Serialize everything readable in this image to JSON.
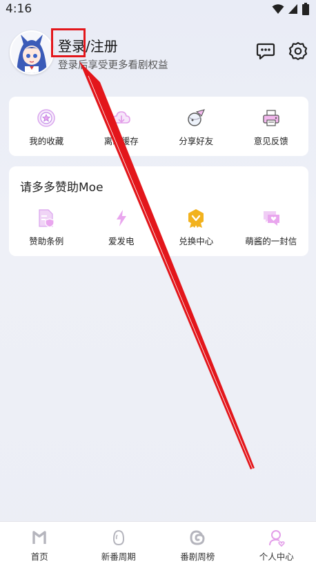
{
  "status_bar": {
    "time": "4:16"
  },
  "profile": {
    "title": "登录/注册",
    "subtitle": "登录后享受更多看剧权益"
  },
  "quick_actions": [
    {
      "label": "我的收藏",
      "icon": "star-badge-icon"
    },
    {
      "label": "离线缓存",
      "icon": "cloud-download-icon"
    },
    {
      "label": "分享好友",
      "icon": "planet-share-icon"
    },
    {
      "label": "意见反馈",
      "icon": "printer-feedback-icon"
    }
  ],
  "sponsor": {
    "title": "请多多赞助Moe",
    "items": [
      {
        "label": "赞助条例",
        "icon": "document-shield-icon"
      },
      {
        "label": "爱发电",
        "icon": "lightning-icon"
      },
      {
        "label": "兑换中心",
        "icon": "medal-icon"
      },
      {
        "label": "萌酱的一封信",
        "icon": "chat-heart-icon"
      }
    ]
  },
  "bottom_nav": [
    {
      "label": "首页",
      "icon": "home-m-icon",
      "active": false
    },
    {
      "label": "新番周期",
      "icon": "egg-icon",
      "active": false
    },
    {
      "label": "番剧周榜",
      "icon": "swirl-icon",
      "active": false
    },
    {
      "label": "个人中心",
      "icon": "person-heart-icon",
      "active": true
    }
  ],
  "colors": {
    "accent_pink": "#e9a6ee",
    "accent_purple": "#c48ee8",
    "gold": "#f2b21e",
    "annotation_red": "#e3161b"
  }
}
